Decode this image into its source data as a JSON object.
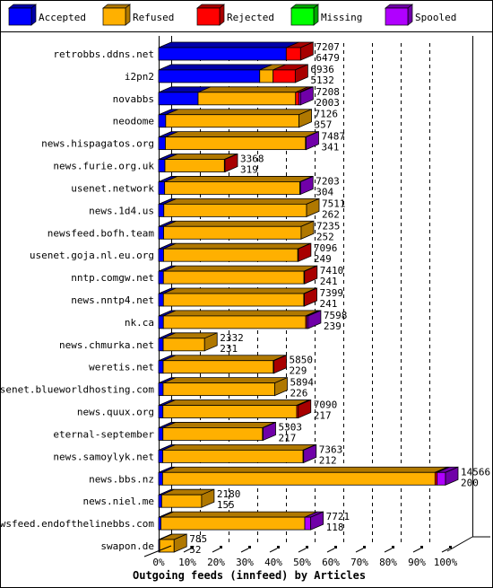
{
  "chart_data": {
    "type": "bar",
    "orientation": "horizontal",
    "stacked": true,
    "style": "3d",
    "title": "Outgoing feeds (innfeed) by Articles",
    "xlim": [
      0,
      100
    ],
    "x_unit": "%",
    "x_ticks": [
      "0%",
      "10%",
      "20%",
      "30%",
      "40%",
      "50%",
      "60%",
      "70%",
      "80%",
      "90%",
      "100%"
    ],
    "grid": "vertical dashed",
    "legend_position": "top",
    "legend": [
      {
        "name": "Accepted",
        "color": "#0000ff",
        "shade": "#0000a8"
      },
      {
        "name": "Refused",
        "color": "#ffb000",
        "shade": "#b07800"
      },
      {
        "name": "Rejected",
        "color": "#ff0000",
        "shade": "#a80000"
      },
      {
        "name": "Missing",
        "color": "#00ff00",
        "shade": "#00a800"
      },
      {
        "name": "Spooled",
        "color": "#b000ff",
        "shade": "#7000a8"
      }
    ],
    "rows": [
      {
        "name": "retrobbs.ddns.net",
        "total": 7207,
        "accepted": 6479,
        "values": [
          6479,
          0,
          728,
          0,
          0
        ]
      },
      {
        "name": "i2pn2",
        "total": 6936,
        "accepted": 5132,
        "values": [
          5132,
          680,
          1124,
          0,
          0
        ]
      },
      {
        "name": "novabbs",
        "total": 7208,
        "accepted": 2003,
        "values": [
          2003,
          4950,
          180,
          0,
          75
        ]
      },
      {
        "name": "neodome",
        "total": 7126,
        "accepted": 357,
        "values": [
          357,
          6769,
          0,
          0,
          0
        ]
      },
      {
        "name": "news.hispagatos.org",
        "total": 7487,
        "accepted": 341,
        "values": [
          341,
          7116,
          0,
          0,
          30
        ]
      },
      {
        "name": "news.furie.org.uk",
        "total": 3368,
        "accepted": 319,
        "values": [
          319,
          3019,
          30,
          0,
          0
        ]
      },
      {
        "name": "usenet.network",
        "total": 7203,
        "accepted": 304,
        "values": [
          304,
          6869,
          0,
          0,
          30
        ]
      },
      {
        "name": "news.1d4.us",
        "total": 7511,
        "accepted": 262,
        "values": [
          262,
          7249,
          0,
          0,
          0
        ]
      },
      {
        "name": "newsfeed.bofh.team",
        "total": 7235,
        "accepted": 252,
        "values": [
          252,
          6983,
          0,
          0,
          0
        ]
      },
      {
        "name": "usenet.goja.nl.eu.org",
        "total": 7096,
        "accepted": 249,
        "values": [
          249,
          6817,
          30,
          0,
          0
        ]
      },
      {
        "name": "nntp.comgw.net",
        "total": 7410,
        "accepted": 241,
        "values": [
          241,
          7139,
          30,
          0,
          0
        ]
      },
      {
        "name": "news.nntp4.net",
        "total": 7399,
        "accepted": 241,
        "values": [
          241,
          7128,
          30,
          0,
          0
        ]
      },
      {
        "name": "nk.ca",
        "total": 7598,
        "accepted": 239,
        "values": [
          239,
          7229,
          60,
          0,
          70
        ]
      },
      {
        "name": "news.chmurka.net",
        "total": 2332,
        "accepted": 231,
        "values": [
          231,
          2101,
          0,
          0,
          0
        ]
      },
      {
        "name": "weretis.net",
        "total": 5850,
        "accepted": 229,
        "values": [
          229,
          5591,
          30,
          0,
          0
        ]
      },
      {
        "name": "usenet.blueworldhosting.com",
        "total": 5894,
        "accepted": 226,
        "values": [
          226,
          5668,
          0,
          0,
          0
        ]
      },
      {
        "name": "news.quux.org",
        "total": 7090,
        "accepted": 217,
        "values": [
          217,
          6793,
          80,
          0,
          0
        ]
      },
      {
        "name": "eternal-september",
        "total": 5303,
        "accepted": 217,
        "values": [
          217,
          5056,
          0,
          0,
          30
        ]
      },
      {
        "name": "news.samoylyk.net",
        "total": 7363,
        "accepted": 212,
        "values": [
          212,
          7121,
          0,
          0,
          30
        ]
      },
      {
        "name": "news.bbs.nz",
        "total": 14566,
        "accepted": 200,
        "values": [
          200,
          13836,
          100,
          0,
          430
        ]
      },
      {
        "name": "news.niel.me",
        "total": 2180,
        "accepted": 155,
        "values": [
          155,
          2025,
          0,
          0,
          0
        ]
      },
      {
        "name": "newsfeed.endofthelinebbs.com",
        "total": 7721,
        "accepted": 118,
        "values": [
          118,
          7303,
          0,
          0,
          300
        ]
      },
      {
        "name": "swapon.de",
        "total": 785,
        "accepted": 52,
        "values": [
          52,
          733,
          0,
          0,
          0
        ]
      }
    ]
  }
}
